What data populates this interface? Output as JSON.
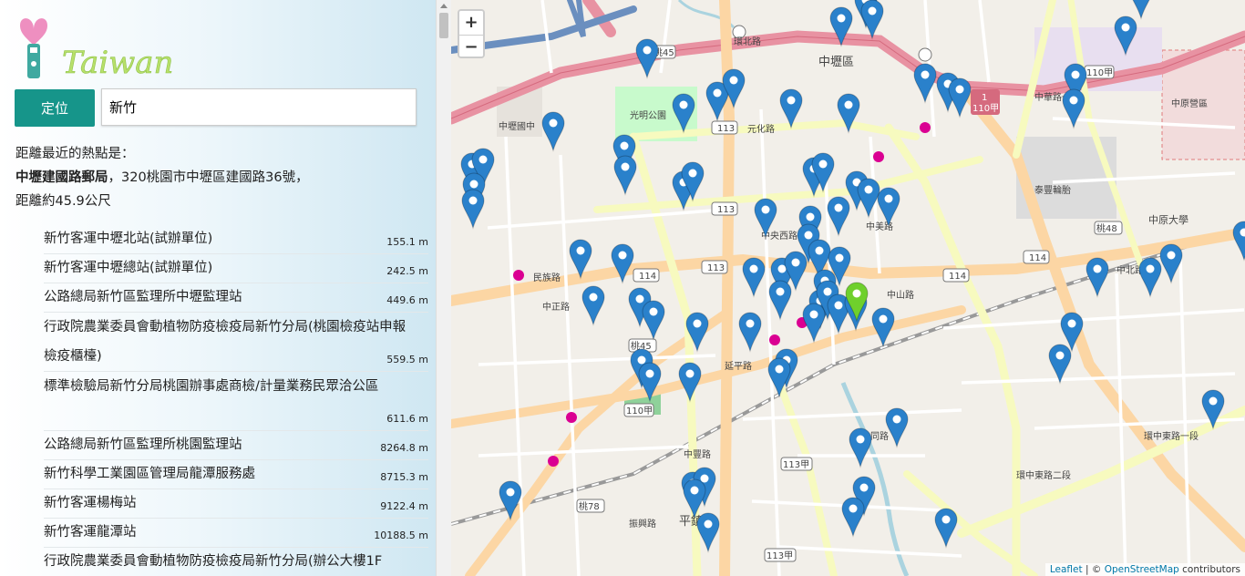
{
  "logo": {
    "heart_color": "#ee8fc0",
    "text_color": "#b8e06a"
  },
  "search": {
    "button_label": "定位",
    "value": "新竹"
  },
  "nearest": {
    "heading": "距離最近的熱點是：",
    "name": "中壢建國路郵局",
    "address": "，320桃園市中壢區建國路36號，",
    "distance": "距離約45.9公尺"
  },
  "results": [
    {
      "name": "新竹客運中壢北站(試辦單位)",
      "dist": "155.1 m"
    },
    {
      "name": "新竹客運中壢總站(試辦單位)",
      "dist": "242.5 m"
    },
    {
      "name": "公路總局新竹區監理所中壢監理站",
      "dist": "449.6 m"
    },
    {
      "name": "行政院農業委員會動植物防疫檢疫局新竹分局(桃園檢疫站申報檢疫櫃檯)",
      "dist": "559.5 m"
    },
    {
      "name": "標準檢驗局新竹分局桃園辦事處商檢/計量業務民眾洽公區",
      "dist": "611.6 m"
    },
    {
      "name": "公路總局新竹區監理所桃園監理站",
      "dist": "8264.8 m"
    },
    {
      "name": "新竹科學工業園區管理局龍潭服務處",
      "dist": "8715.3 m"
    },
    {
      "name": "新竹客運楊梅站",
      "dist": "9122.4 m"
    },
    {
      "name": "新竹客運龍潭站",
      "dist": "10188.5 m"
    },
    {
      "name": "行政院農業委員會動植物防疫檢疫局新竹分局(辦公大樓1F",
      "dist": ""
    }
  ],
  "map": {
    "zoom_in": "+",
    "zoom_out": "−",
    "attribution_leaflet": "Leaflet",
    "attribution_sep": " | © ",
    "attribution_osm": "OpenStreetMap",
    "attribution_tail": " contributors",
    "pin_color": "#2a81cb",
    "selected_pin_color": "#6fd02c",
    "labels": {
      "district": "中壢區",
      "park": "光明公園",
      "station": "中壢國中",
      "bldg": "泰豐輪胎",
      "univ": "中原大學",
      "camp": "中原營區",
      "pingzhen": "平鎮區",
      "r1": "環北路",
      "r2": "元化路",
      "r3": "中央西路",
      "r4": "延平路",
      "r5": "中山路",
      "r6": "民族路",
      "r7": "中正路",
      "r8": "中華路一段",
      "r9": "環中東路二段",
      "r10": "環中東路一段",
      "r11": "中北路",
      "r12": "中豐路",
      "r13": "振興路",
      "r14": "大同路",
      "r15": "中美路",
      "s113": "113",
      "s114": "114",
      "s110": "110甲",
      "sT45": "桃45",
      "sT78": "桃78",
      "s1": "1",
      "s1b": "110甲",
      "s113b": "113甲",
      "s110b": "110甲",
      "sT48": "桃48"
    }
  }
}
